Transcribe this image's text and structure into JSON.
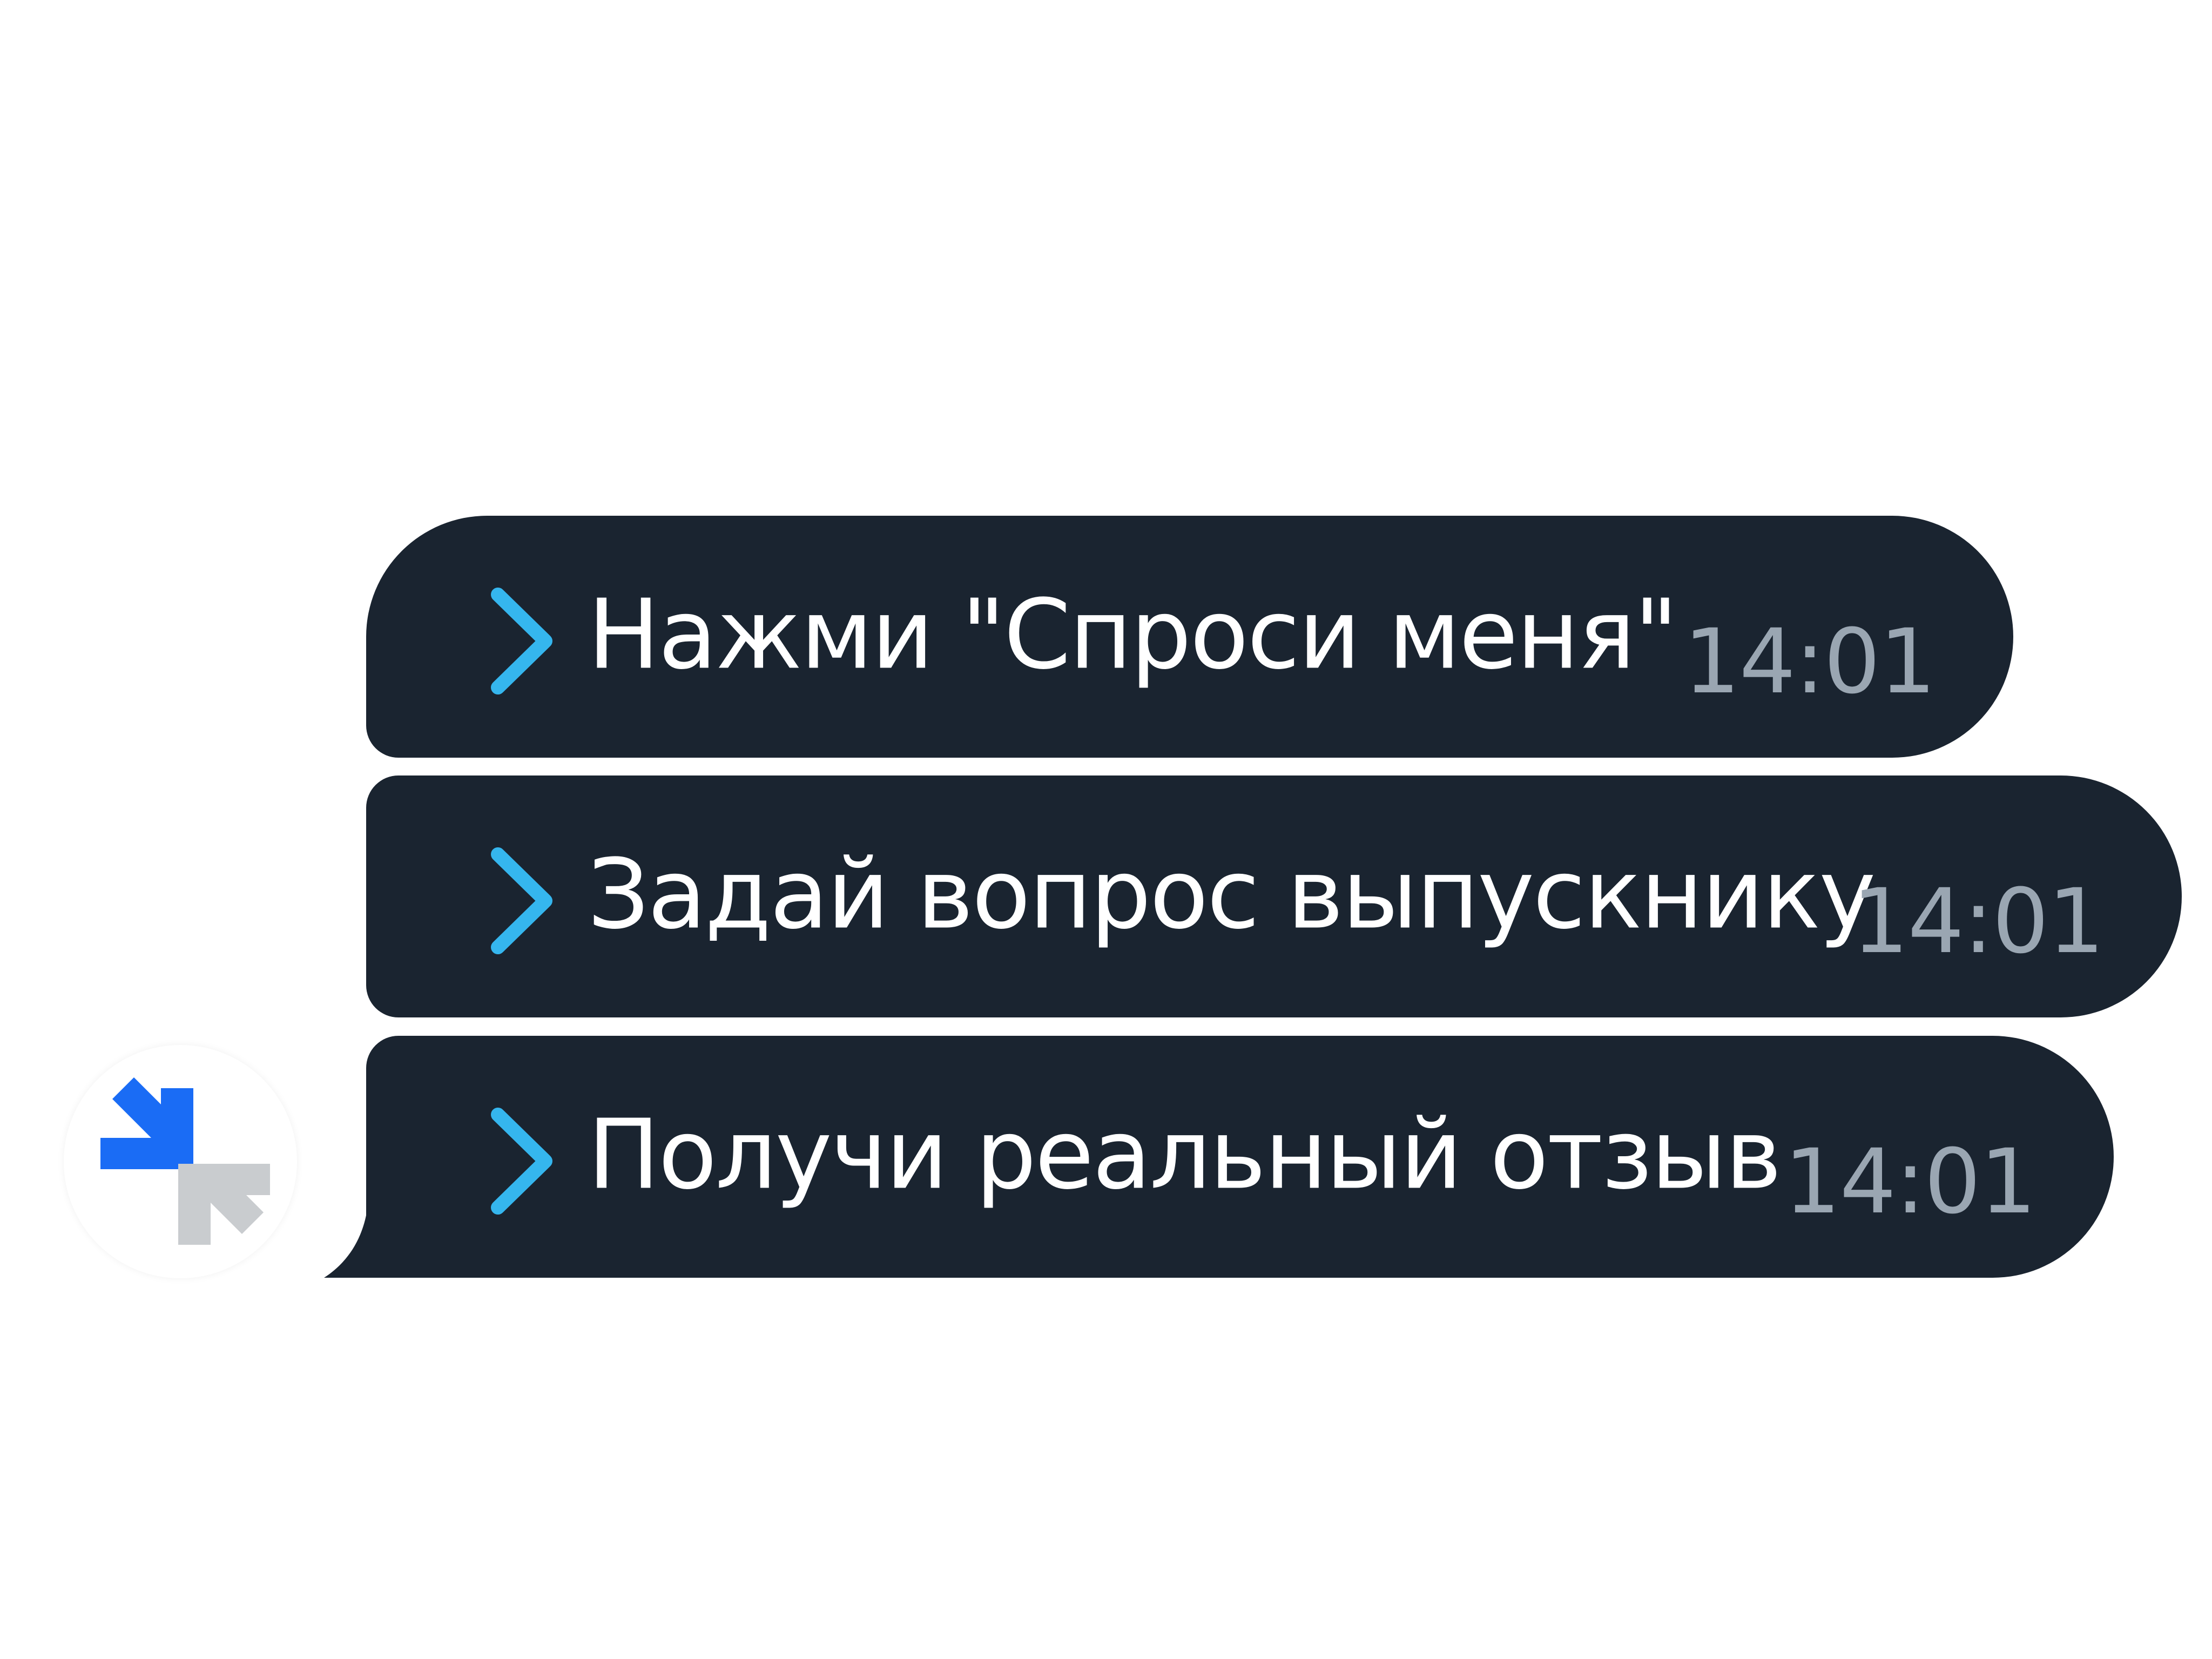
{
  "messages": [
    {
      "text": "Нажми \"Спроси меня\"",
      "time": "14:01"
    },
    {
      "text": "Задай вопрос выпускнику",
      "time": "14:01"
    },
    {
      "text": "Получи реальный отзыв",
      "time": "14:01"
    }
  ],
  "avatar": {
    "icon": "collapse-arrows-logo"
  },
  "colors": {
    "bubble_bg": "#1a2430",
    "text": "#ffffff",
    "time": "#9aa6b2",
    "chevron": "#35b6ee",
    "logo_blue": "#1a6cf5",
    "logo_gray": "#c9cccf"
  }
}
